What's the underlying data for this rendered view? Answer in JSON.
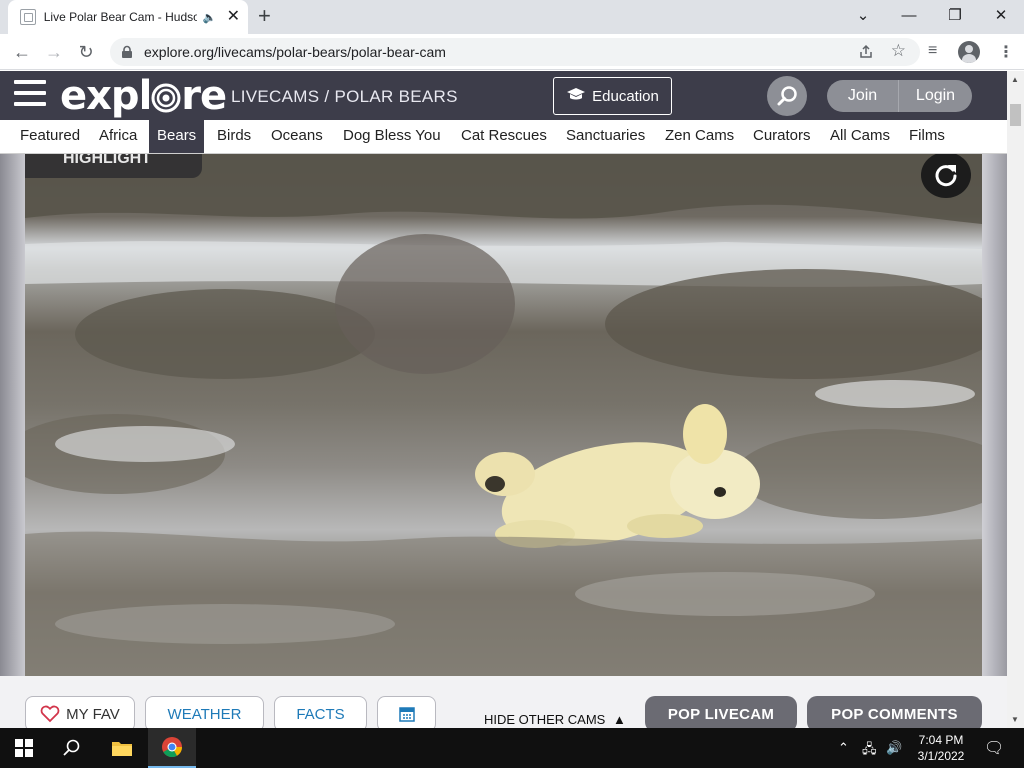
{
  "browser": {
    "tab_title": "Live Polar Bear Cam - Hudso",
    "url": "explore.org/livecams/polar-bears/polar-bear-cam"
  },
  "site": {
    "logo": "explore",
    "breadcrumb": "LIVECAMS / POLAR BEARS",
    "education_label": "Education",
    "join_label": "Join",
    "login_label": "Login",
    "categories": [
      {
        "label": "Featured"
      },
      {
        "label": "Africa"
      },
      {
        "label": "Bears",
        "active": true
      },
      {
        "label": "Birds"
      },
      {
        "label": "Oceans"
      },
      {
        "label": "Dog Bless You"
      },
      {
        "label": "Cat Rescues"
      },
      {
        "label": "Sanctuaries"
      },
      {
        "label": "Zen Cams"
      },
      {
        "label": "Curators"
      },
      {
        "label": "All Cams"
      },
      {
        "label": "Films"
      }
    ]
  },
  "player": {
    "highlight_label": "HIGHLIGHT",
    "my_fav_label": "MY FAV",
    "weather_label": "WEATHER",
    "facts_label": "FACTS",
    "hide_cams_label": "HIDE OTHER CAMS",
    "pop_livecam_label": "POP LIVECAM",
    "pop_comments_label": "POP COMMENTS"
  },
  "taskbar": {
    "time": "7:04 PM",
    "date": "3/1/2022"
  },
  "colors": {
    "site_header": "#3d3d4a",
    "link_blue": "#1e7ab8",
    "pop_button": "#6b6b73"
  }
}
